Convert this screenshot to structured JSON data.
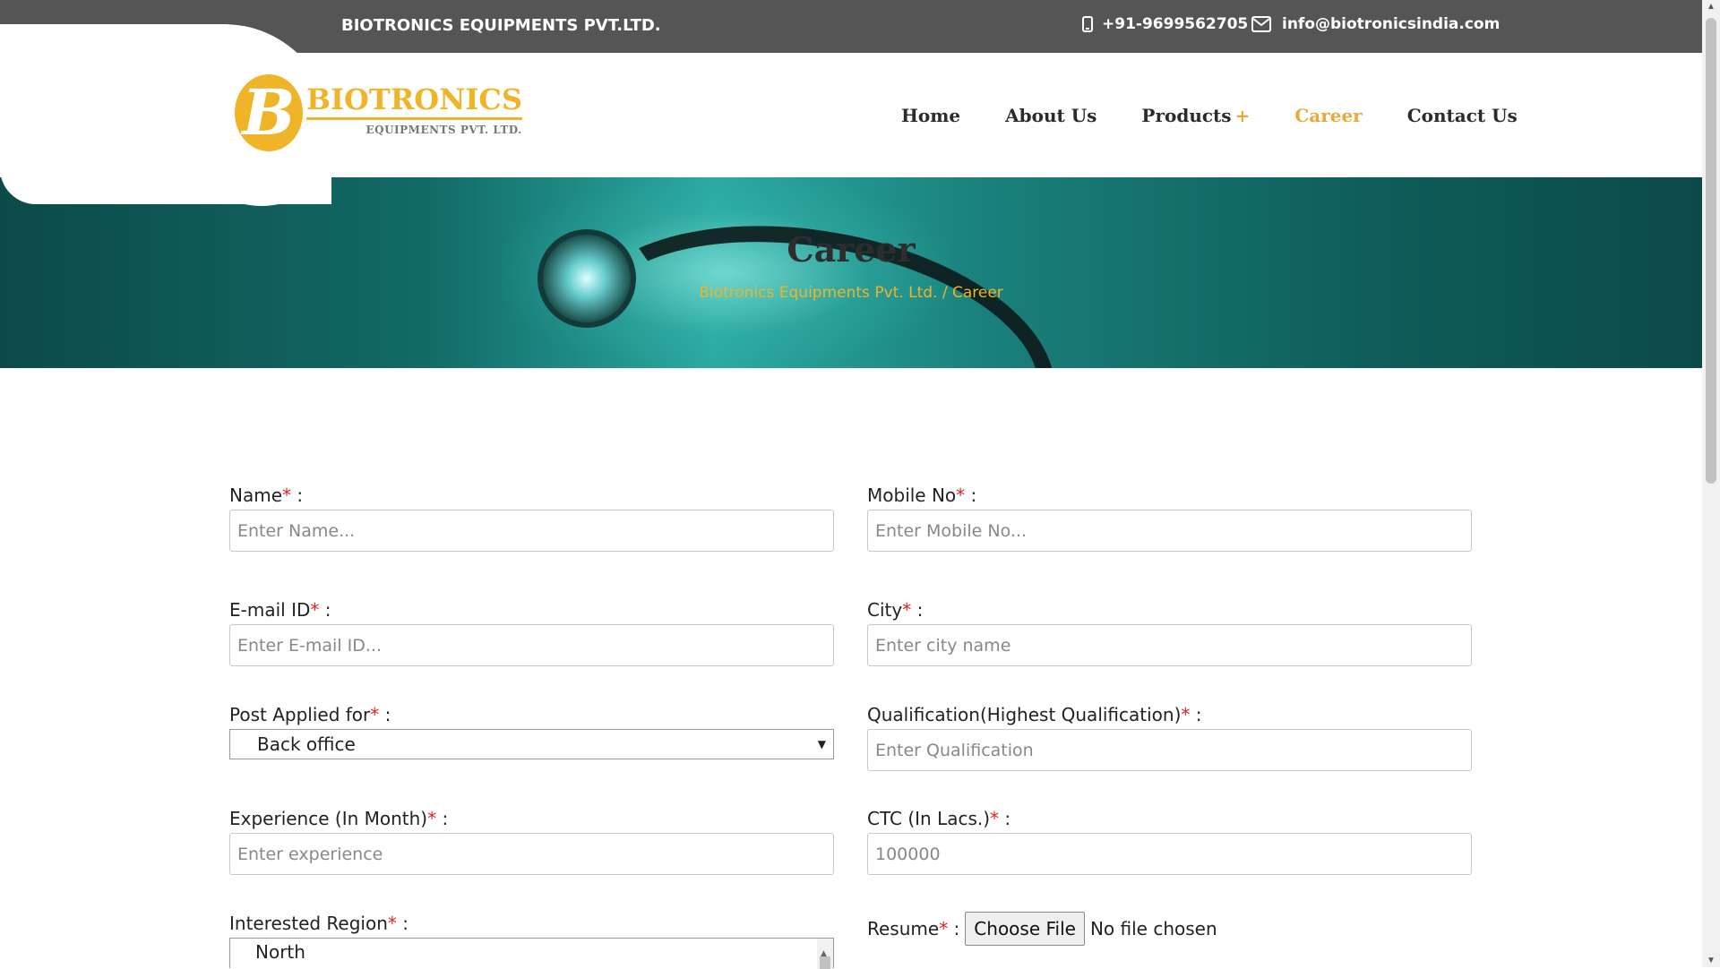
{
  "topbar": {
    "company": "BIOTRONICS EQUIPMENTS PVT.LTD.",
    "phone": "+91-9699562705",
    "email": "info@biotronicsindia.com"
  },
  "logo": {
    "mark": "B",
    "brand": "BIOTRONICS",
    "sub": "EQUIPMENTS PVT. LTD."
  },
  "nav": {
    "items": [
      {
        "label": "Home"
      },
      {
        "label": "About Us"
      },
      {
        "label": "Products",
        "suffix": "+"
      },
      {
        "label": "Career",
        "active": true
      },
      {
        "label": "Contact Us"
      }
    ]
  },
  "banner": {
    "title": "Career",
    "breadcrumb_home": "Biotronics Equipments Pvt. Ltd.",
    "breadcrumb_sep": "/",
    "breadcrumb_current": "Career"
  },
  "form": {
    "required_mark": "*",
    "colon": ":",
    "name": {
      "label": "Name",
      "placeholder": "Enter Name..."
    },
    "mobile": {
      "label": "Mobile No",
      "placeholder": "Enter Mobile No..."
    },
    "email": {
      "label": "E-mail ID",
      "placeholder": "Enter E-mail ID..."
    },
    "city": {
      "label": "City",
      "placeholder": "Enter city name"
    },
    "post": {
      "label": "Post Applied for",
      "value": "Back office"
    },
    "qualification": {
      "label": "Qualification(Highest Qualification)",
      "placeholder": "Enter Qualification"
    },
    "experience": {
      "label": "Experience (In Month)",
      "placeholder": "Enter experience"
    },
    "ctc": {
      "label": "CTC (In Lacs.)",
      "placeholder": "100000"
    },
    "region": {
      "label": "Interested Region",
      "value": "North"
    },
    "resume": {
      "label": "Resume",
      "button": "Choose File",
      "status": "No file chosen"
    }
  },
  "icons": {
    "phone": "mobile-phone-icon",
    "email": "envelope-icon",
    "dropdown": "caret-down-icon"
  },
  "colors": {
    "accent": "#f0b429",
    "topbar": "#555555",
    "required": "#e02424"
  }
}
